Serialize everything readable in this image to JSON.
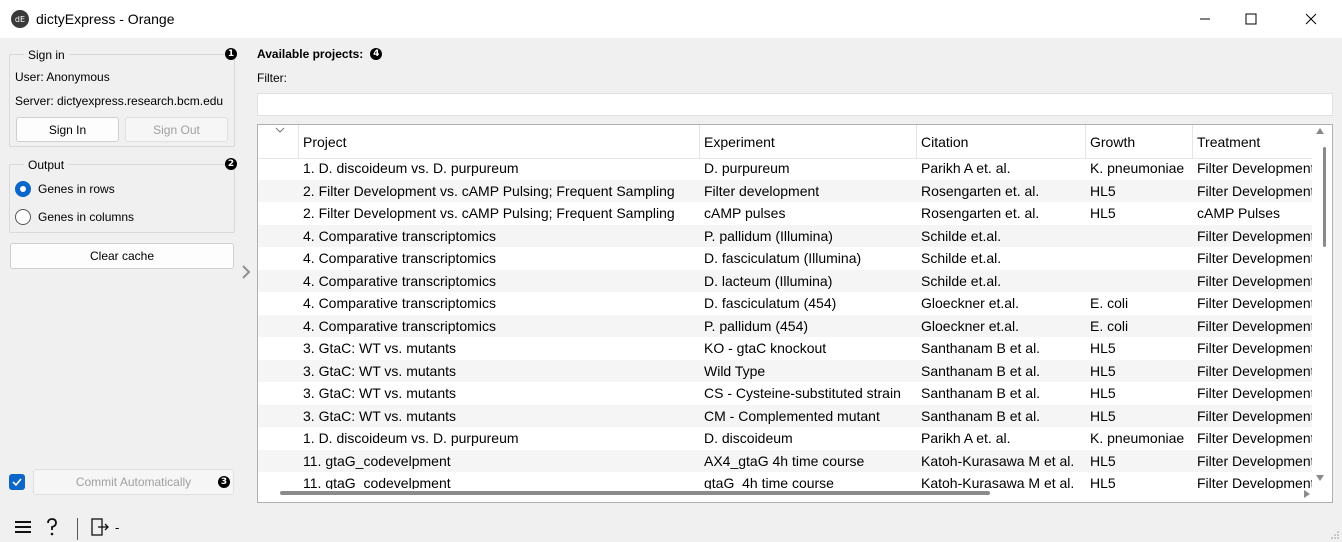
{
  "window": {
    "title": "dictyExpress - Orange",
    "app_icon_text": "dE"
  },
  "sign_in": {
    "title": "Sign in",
    "badge": "1",
    "user_line": "User: Anonymous",
    "server_line": "Server: dictyexpress.research.bcm.edu",
    "sign_in_label": "Sign In",
    "sign_out_label": "Sign Out"
  },
  "output": {
    "title": "Output",
    "badge": "2",
    "options": [
      "Genes in rows",
      "Genes in columns"
    ],
    "selected_index": 0
  },
  "clear_cache_label": "Clear cache",
  "commit": {
    "label": "Commit Automatically",
    "badge": "3",
    "checked": true
  },
  "main": {
    "heading": "Available projects:",
    "badge": "4",
    "filter_label": "Filter:",
    "filter_value": ""
  },
  "table": {
    "columns": [
      "Project",
      "Experiment",
      "Citation",
      "Growth",
      "Treatment"
    ],
    "rows": [
      [
        "1.  D. discoideum vs. D. purpureum",
        "D. purpureum",
        "Parikh A et. al.",
        "K. pneumoniae",
        "Filter Development"
      ],
      [
        "2.  Filter Development vs. cAMP Pulsing; Frequent Sampling",
        "Filter development",
        "Rosengarten et. al.",
        "HL5",
        "Filter Development"
      ],
      [
        "2.  Filter Development vs. cAMP Pulsing; Frequent Sampling",
        "cAMP pulses",
        "Rosengarten et. al.",
        "HL5",
        "cAMP Pulses"
      ],
      [
        "4.  Comparative transcriptomics",
        "P. pallidum (Illumina)",
        "Schilde et.al.",
        "",
        "Filter Development"
      ],
      [
        "4.  Comparative transcriptomics",
        "D. fasciculatum (Illumina)",
        "Schilde et.al.",
        "",
        "Filter Development"
      ],
      [
        "4.  Comparative transcriptomics",
        "D. lacteum (Illumina)",
        "Schilde et.al.",
        "",
        "Filter Development"
      ],
      [
        "4.  Comparative transcriptomics",
        "D. fasciculatum (454)",
        "Gloeckner et.al.",
        "E. coli",
        "Filter Development"
      ],
      [
        "4.  Comparative transcriptomics",
        "P. pallidum (454)",
        "Gloeckner et.al.",
        "E. coli",
        "Filter Development"
      ],
      [
        "3.  GtaC: WT vs. mutants",
        "KO - gtaC knockout",
        "Santhanam B et al.",
        "HL5",
        "Filter Development"
      ],
      [
        "3.  GtaC: WT vs. mutants",
        "Wild Type",
        "Santhanam B et al.",
        "HL5",
        "Filter Development"
      ],
      [
        "3.  GtaC: WT vs. mutants",
        "CS - Cysteine-substituted strain",
        "Santhanam B et al.",
        "HL5",
        "Filter Development"
      ],
      [
        "3.  GtaC: WT vs. mutants",
        "CM - Complemented mutant",
        "Santhanam B et al.",
        "HL5",
        "Filter Development"
      ],
      [
        "1.  D. discoideum vs. D. purpureum",
        "D. discoideum",
        "Parikh A et. al.",
        "K. pneumoniae",
        "Filter Development"
      ],
      [
        "11.  gtaG_codevelpment",
        "AX4_gtaG 4h time course",
        "Katoh-Kurasawa M et al.",
        "HL5",
        "Filter Development"
      ],
      [
        "11.  gtaG_codevelpment",
        "gtaG_4h time course",
        "Katoh-Kurasawa M et al.",
        "HL5",
        "Filter Development"
      ]
    ]
  },
  "status": {
    "text": "-"
  },
  "icons": {
    "menu": "hamburger-icon",
    "help": "help-icon",
    "output": "output-icon"
  }
}
